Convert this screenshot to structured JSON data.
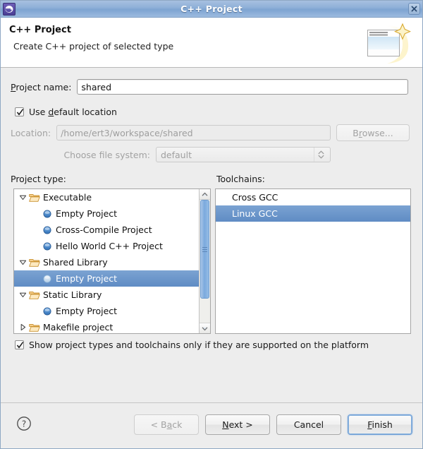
{
  "window": {
    "title": "C++ Project",
    "app_icon": "eclipse-icon",
    "close_icon": "close-icon"
  },
  "header": {
    "title": "C++ Project",
    "description": "Create C++ project of selected type",
    "banner_icon": "new-project-wizard-icon"
  },
  "form": {
    "project_name_label": "Project name:",
    "project_name_value": "shared",
    "project_name_placeholder": "",
    "use_default_location_label": "Use default location",
    "use_default_location_checked": true,
    "location_label": "Location:",
    "location_value": "/home/ert3/workspace/shared",
    "location_enabled": false,
    "browse_label": "Browse...",
    "browse_enabled": false,
    "file_system_label": "Choose file system:",
    "file_system_value": "default",
    "file_system_enabled": false,
    "file_system_options": [
      "default"
    ]
  },
  "project_type": {
    "label": "Project type:",
    "rows": [
      {
        "label": "Executable",
        "icon": "folder-open-icon",
        "twisty": "expanded",
        "depth": 0,
        "selected": false
      },
      {
        "label": "Empty Project",
        "icon": "sphere-icon",
        "twisty": "none",
        "depth": 1,
        "selected": false
      },
      {
        "label": "Cross-Compile Project",
        "icon": "sphere-icon",
        "twisty": "none",
        "depth": 1,
        "selected": false
      },
      {
        "label": "Hello World C++ Project",
        "icon": "sphere-icon",
        "twisty": "none",
        "depth": 1,
        "selected": false
      },
      {
        "label": "Shared Library",
        "icon": "folder-open-icon",
        "twisty": "expanded",
        "depth": 0,
        "selected": false
      },
      {
        "label": "Empty Project",
        "icon": "sphere-icon",
        "twisty": "none",
        "depth": 1,
        "selected": true
      },
      {
        "label": "Static Library",
        "icon": "folder-open-icon",
        "twisty": "expanded",
        "depth": 0,
        "selected": false
      },
      {
        "label": "Empty Project",
        "icon": "sphere-icon",
        "twisty": "none",
        "depth": 1,
        "selected": false
      },
      {
        "label": "Makefile project",
        "icon": "folder-open-icon",
        "twisty": "collapsed",
        "depth": 0,
        "selected": false
      }
    ],
    "scrollbar": {
      "up_icon": "chevron-up-icon",
      "down_icon": "chevron-down-icon",
      "thumb_position_pct": 0,
      "thumb_size_pct": 82
    }
  },
  "toolchains": {
    "label": "Toolchains:",
    "rows": [
      {
        "label": "Cross GCC",
        "selected": false
      },
      {
        "label": "Linux GCC",
        "selected": true
      }
    ]
  },
  "options": {
    "show_supported_label": "Show project types and toolchains only if they are supported on the platform",
    "show_supported_checked": true
  },
  "footer": {
    "help_icon": "help-icon",
    "buttons": [
      {
        "label": "< Back",
        "enabled": false,
        "focused": false
      },
      {
        "label": "Next >",
        "enabled": true,
        "focused": false
      },
      {
        "label": "Cancel",
        "enabled": true,
        "focused": false
      },
      {
        "label": "Finish",
        "enabled": true,
        "focused": true
      }
    ]
  },
  "colors": {
    "selection_blue": "#6f9dcf",
    "titlebar_blue": "#8fb0d8",
    "folder_orange": "#e8a33d",
    "sphere_blue": "#3f7fc4",
    "dialog_gray": "#ededed"
  }
}
